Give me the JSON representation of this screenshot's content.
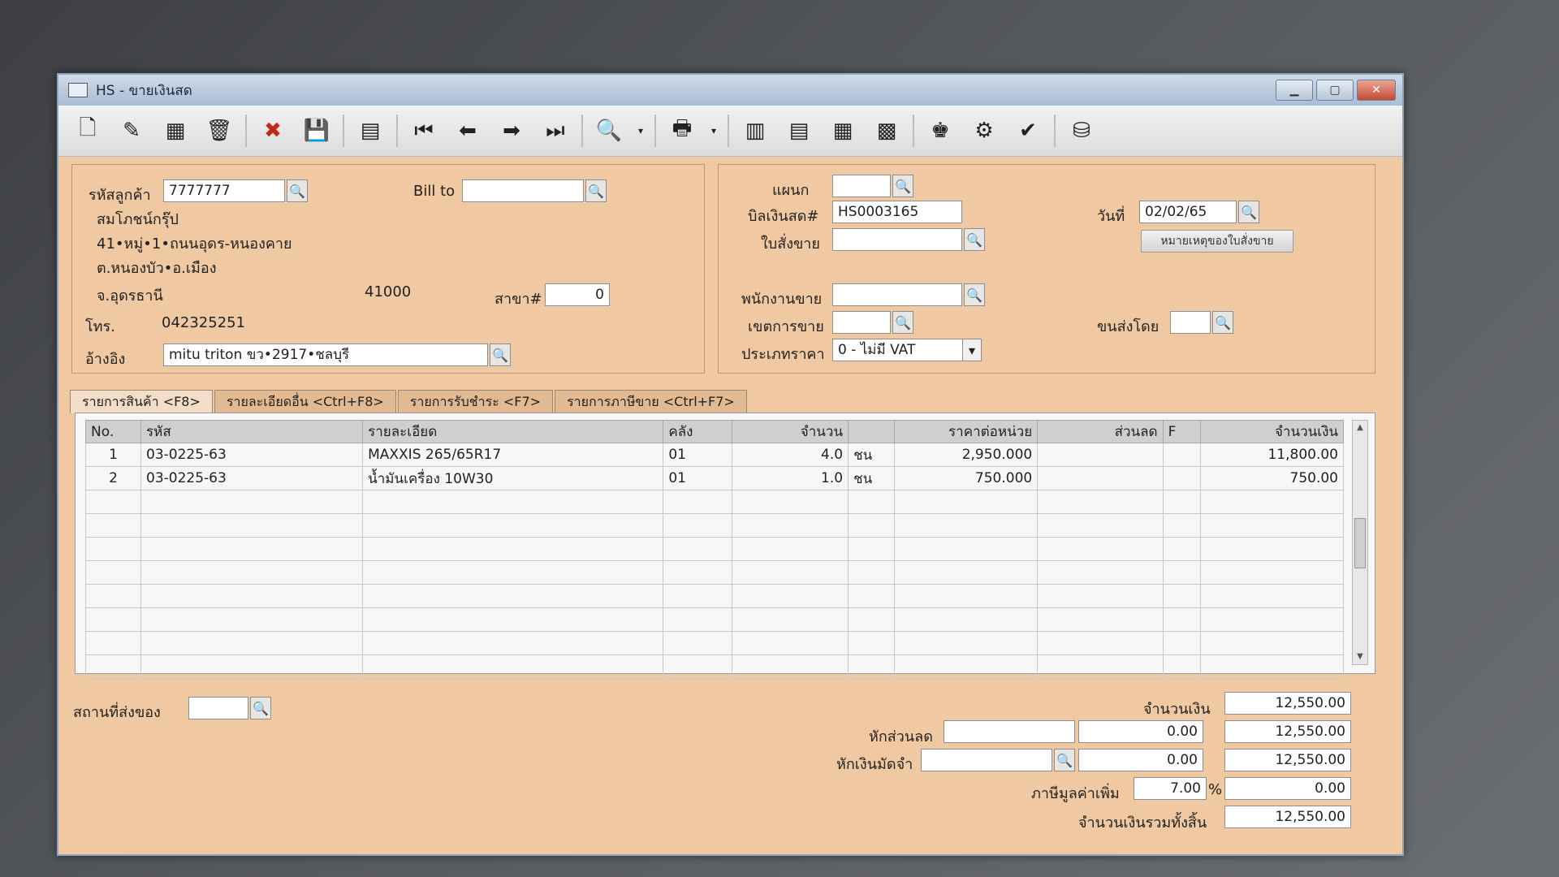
{
  "window": {
    "title": "HS - ขายเงินสด",
    "min_icon": "minimize-icon",
    "max_icon": "maximize-icon",
    "close_icon": "close-icon"
  },
  "toolbar": [
    {
      "name": "new-document-icon",
      "glyph": "🗋"
    },
    {
      "name": "edit-icon",
      "glyph": "✎"
    },
    {
      "name": "void-icon",
      "glyph": "▦"
    },
    {
      "name": "delete-icon",
      "glyph": "🗑"
    },
    {
      "name": "cancel-icon",
      "glyph": "✖"
    },
    {
      "name": "save-icon",
      "glyph": "💾"
    },
    {
      "name": "copy-icon",
      "glyph": "▤"
    },
    {
      "name": "first-record-icon",
      "glyph": "⏮"
    },
    {
      "name": "prev-record-icon",
      "glyph": "⬅"
    },
    {
      "name": "next-record-icon",
      "glyph": "➡"
    },
    {
      "name": "last-record-icon",
      "glyph": "⏭"
    },
    {
      "name": "find-icon",
      "glyph": "🔍"
    },
    {
      "name": "print-icon",
      "glyph": "🖶"
    },
    {
      "name": "report-icon",
      "glyph": "▥"
    },
    {
      "name": "form-icon",
      "glyph": "▤"
    },
    {
      "name": "calculator-icon",
      "glyph": "▦"
    },
    {
      "name": "calendar-icon",
      "glyph": "▩"
    },
    {
      "name": "approve-ok-icon",
      "glyph": "♚"
    },
    {
      "name": "cancel-ok-icon",
      "glyph": "⚙"
    },
    {
      "name": "ok-icon",
      "glyph": "✔"
    },
    {
      "name": "export-icon",
      "glyph": "⛁"
    }
  ],
  "customer": {
    "code_label": "รหัสลูกค้า",
    "code_value": "7777777",
    "bill_to_label": "Bill to",
    "bill_to_value": "",
    "name": "สมโภชน์กรุ๊ป",
    "address1": "41•หมู่•1•ถนนอุดร-หนองคาย",
    "address2": "ต.หนองบัว•อ.เมือง",
    "province": "จ.อุดรธานี",
    "postcode": "41000",
    "branch_label": "สาขา#",
    "branch_value": "0",
    "phone_label": "โทร.",
    "phone_value": "042325251",
    "reference_label": "อ้างอิง",
    "reference_value": "mitu triton ขว•2917•ชลบุรี"
  },
  "bill": {
    "department_label": "แผนก",
    "department_value": "",
    "cash_bill_label": "บิลเงินสด#",
    "cash_bill_value": "HS0003165",
    "sales_order_label": "ใบสั่งขาย",
    "sales_order_value": "",
    "date_label": "วันที่",
    "date_value": "02/02/65",
    "order_note_button": "หมายเหตุของใบสั่งขาย",
    "salesperson_label": "พนักงานขาย",
    "salesperson_value": "",
    "sales_area_label": "เขตการขาย",
    "sales_area_value": "",
    "ship_by_label": "ขนส่งโดย",
    "ship_by_value": "",
    "price_type_label": "ประเภทราคา",
    "price_type_value": "0 - ไม่มี VAT"
  },
  "tabs": [
    "รายการสินค้า <F8>",
    "รายละเอียดอื่น <Ctrl+F8>",
    "รายการรับชำระ <F7>",
    "รายการภาษีขาย <Ctrl+F7>"
  ],
  "grid": {
    "headers": [
      "No.",
      "รหัส",
      "รายละเอียด",
      "คลัง",
      "จำนวน",
      "",
      "ราคาต่อหน่วย",
      "ส่วนลด",
      "F",
      "จำนวนเงิน"
    ],
    "rows": [
      [
        "1",
        "03-0225-63",
        "MAXXIS 265/65R17",
        "01",
        "4.0",
        "ชน",
        "2,950.000",
        "",
        "",
        "11,800.00"
      ],
      [
        "2",
        "03-0225-63",
        "น้ำมันเครื่อง 10W30",
        "01",
        "1.0",
        "ชน",
        "750.000",
        "",
        "",
        "750.00"
      ]
    ]
  },
  "totals": {
    "delivery_place_label": "สถานที่ส่งของ",
    "delivery_place_value": "",
    "amount_label": "จำนวนเงิน",
    "amount_value": "12,550.00",
    "discount_label": "หักส่วนลด",
    "discount_text": "",
    "discount_amount": "0.00",
    "discount_result": "12,550.00",
    "deposit_label": "หักเงินมัดจำ",
    "deposit_text": "",
    "deposit_amount": "0.00",
    "deposit_result": "12,550.00",
    "vat_label": "ภาษีมูลค่าเพิ่ม",
    "vat_rate": "7.00",
    "vat_percent_sign": "%",
    "vat_amount": "0.00",
    "grand_total_label": "จำนวนเงินรวมทั้งสิ้น",
    "grand_total_value": "12,550.00"
  }
}
